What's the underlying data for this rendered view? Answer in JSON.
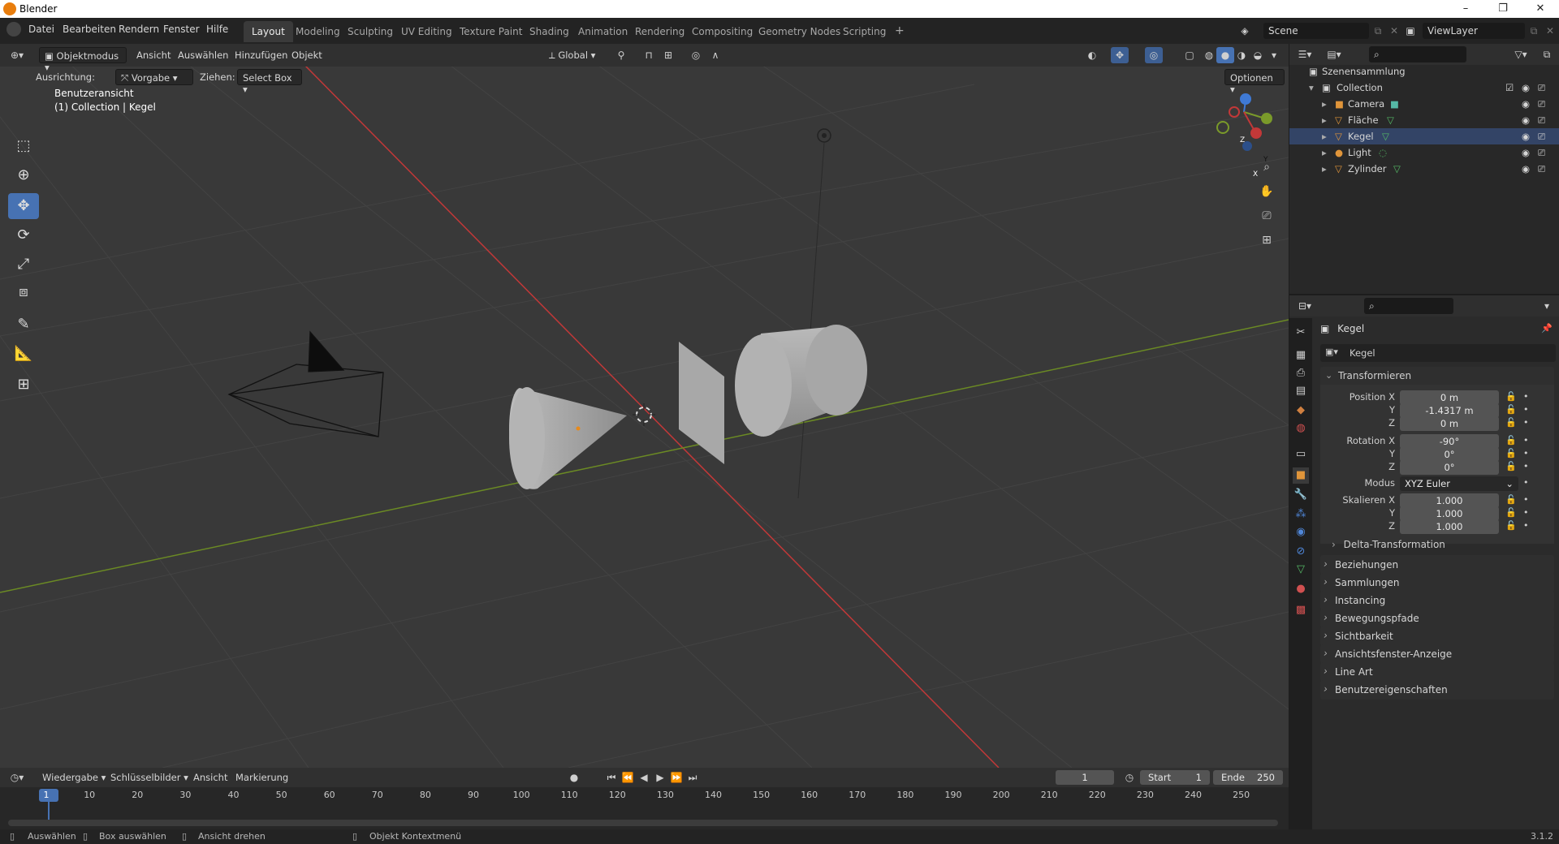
{
  "window": {
    "title": "Blender",
    "controls": [
      "–",
      "❐",
      "✕"
    ]
  },
  "menu": {
    "items": [
      "Datei",
      "Bearbeiten",
      "Rendern",
      "Fenster",
      "Hilfe"
    ],
    "workspaces": [
      "Layout",
      "Modeling",
      "Sculpting",
      "UV Editing",
      "Texture Paint",
      "Shading",
      "Animation",
      "Rendering",
      "Compositing",
      "Geometry Nodes",
      "Scripting"
    ],
    "active_workspace": "Layout",
    "add_tab": "+",
    "scene": "Scene",
    "view_layer": "ViewLayer"
  },
  "viewport": {
    "mode": "Objektmodus",
    "header_menus": [
      "Ansicht",
      "Auswählen",
      "Hinzufügen",
      "Objekt"
    ],
    "orientation": "Global",
    "tool_settings": {
      "ausrichtung_label": "Ausrichtung:",
      "ausrichtung_value": "Vorgabe",
      "ziehen_label": "Ziehen:",
      "ziehen_value": "Select Box",
      "optionen": "Optionen"
    },
    "view_name": "Benutzeransicht",
    "collection_info": "(1) Collection | Kegel",
    "gizmo": {
      "x": "X",
      "y": "Y",
      "z": "Z"
    }
  },
  "outliner": {
    "root": "Szenensammlung",
    "collection": "Collection",
    "objects": [
      "Camera",
      "Fläche",
      "Kegel",
      "Light",
      "Zylinder"
    ]
  },
  "properties": {
    "object_name": "Kegel",
    "data_name": "Kegel",
    "transform_title": "Transformieren",
    "position": {
      "label": "Position X",
      "x": "0 m",
      "y": "-1.4317 m",
      "z": "0 m"
    },
    "rotation": {
      "label": "Rotation X",
      "x": "-90°",
      "y": "0°",
      "z": "0°"
    },
    "modus": {
      "label": "Modus",
      "value": "XYZ Euler"
    },
    "scale": {
      "label": "Skalieren X",
      "x": "1.000",
      "y": "1.000",
      "z": "1.000"
    },
    "axis_y": "Y",
    "axis_z": "Z",
    "delta": "Delta-Transformation",
    "sections": [
      "Beziehungen",
      "Sammlungen",
      "Instancing",
      "Bewegungspfade",
      "Sichtbarkeit",
      "Ansichtsfenster-Anzeige",
      "Line Art",
      "Benutzereigenschaften"
    ]
  },
  "timeline": {
    "menus": [
      "Wiedergabe",
      "Schlüsselbilder",
      "Ansicht",
      "Markierung"
    ],
    "current_frame": "1",
    "start_label": "Start",
    "start": "1",
    "end_label": "Ende",
    "end": "250",
    "ticks": [
      "1",
      "10",
      "20",
      "30",
      "40",
      "50",
      "60",
      "70",
      "80",
      "90",
      "100",
      "110",
      "120",
      "130",
      "140",
      "150",
      "160",
      "170",
      "180",
      "190",
      "200",
      "210",
      "220",
      "230",
      "240",
      "250"
    ]
  },
  "statusbar": {
    "items": [
      "Auswählen",
      "Box auswählen",
      "Ansicht drehen",
      "Objekt Kontextmenü"
    ],
    "version": "3.1.2"
  },
  "colors": {
    "accent": "#4772b3",
    "x_axis": "#c23838",
    "y_axis": "#7a9a2a",
    "z_axis": "#3f7ad6"
  }
}
